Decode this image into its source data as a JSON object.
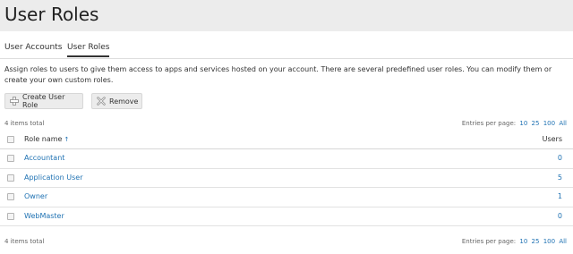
{
  "page": {
    "title": "User Roles"
  },
  "tabs": [
    {
      "label": "User Accounts",
      "active": false
    },
    {
      "label": "User Roles",
      "active": true
    }
  ],
  "hint": "Assign roles to users to give them access to apps and services hosted on your account. There are several predefined user roles. You can modify them or create your own custom roles.",
  "toolbar": {
    "create_label": "Create User Role",
    "create_icon": "add-role-icon",
    "remove_label": "Remove",
    "remove_icon": "remove-icon"
  },
  "list": {
    "total_top": "4 items total",
    "total_bottom": "4 items total",
    "pager_label": "Entries per page:",
    "pager_options": [
      "10",
      "25",
      "100",
      "All"
    ],
    "columns": {
      "name": "Role name",
      "users": "Users",
      "sort_icon": "sort-ascending-icon",
      "sort_glyph": "↑"
    },
    "rows": [
      {
        "name": "Accountant",
        "users": "0"
      },
      {
        "name": "Application User",
        "users": "5"
      },
      {
        "name": "Owner",
        "users": "1"
      },
      {
        "name": "WebMaster",
        "users": "0"
      }
    ]
  },
  "colors": {
    "link": "#1f72b3",
    "header_bg": "#ececec",
    "button_bg": "#ececec"
  }
}
